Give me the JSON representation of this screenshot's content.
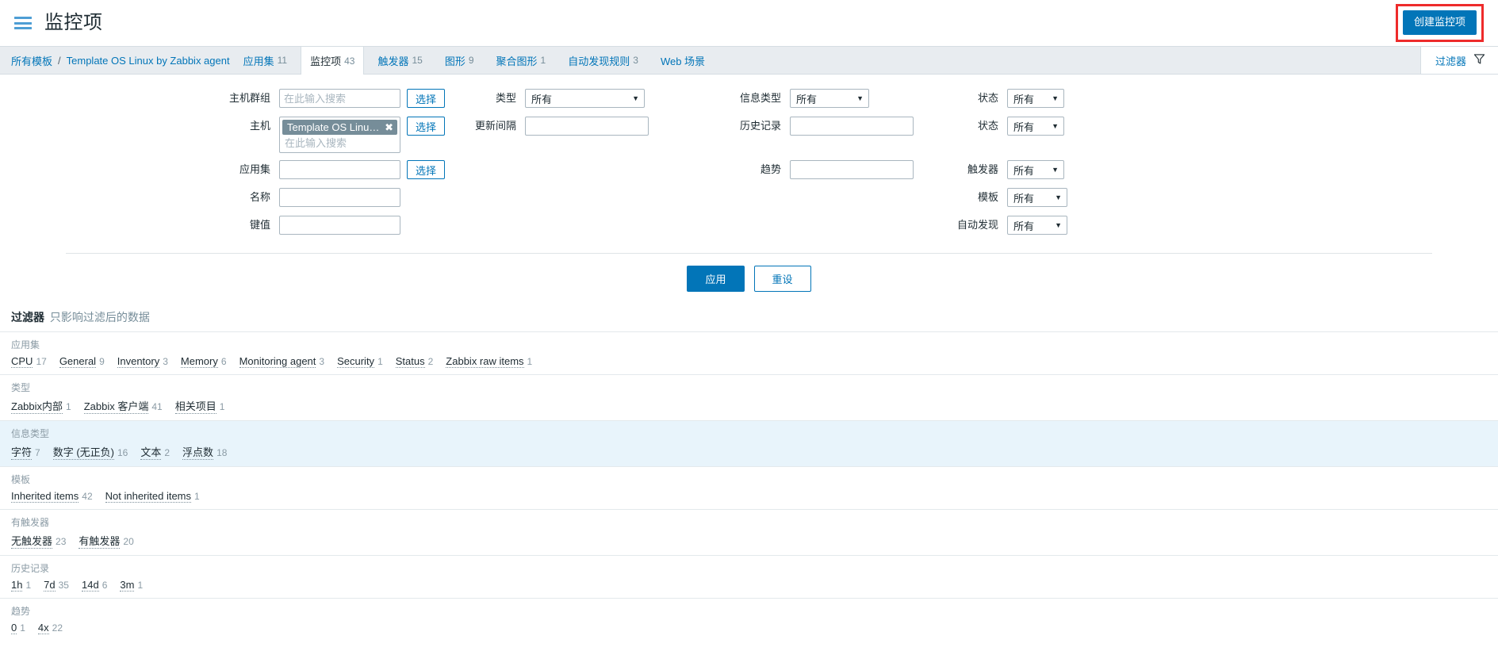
{
  "header": {
    "menu_icon": "hamburger-icon",
    "title": "监控项",
    "create_button": "创建监控项",
    "highlight_color": "#ee2b2b",
    "accent_color": "#0275b8"
  },
  "breadcrumb": {
    "all_templates": "所有模板",
    "separator": "/",
    "template_name": "Template OS Linux by Zabbix agent",
    "tabs": [
      {
        "label": "应用集",
        "count": "11",
        "selected": false
      },
      {
        "label": "监控项",
        "count": "43",
        "selected": true
      },
      {
        "label": "触发器",
        "count": "15",
        "selected": false
      },
      {
        "label": "图形",
        "count": "9",
        "selected": false
      },
      {
        "label": "聚合图形",
        "count": "1",
        "selected": false
      },
      {
        "label": "自动发现规则",
        "count": "3",
        "selected": false
      },
      {
        "label": "Web 场景",
        "count": "",
        "selected": false
      }
    ],
    "filter_tab": {
      "label": "过滤器",
      "icon": "funnel-icon"
    }
  },
  "filter": {
    "col1": {
      "host_group_label": "主机群组",
      "host_group_placeholder": "在此输入搜索",
      "host_group_value": "",
      "host_group_select": "选择",
      "host_label": "主机",
      "host_chip": "Template OS Linux ...",
      "host_chip_remove": "✖",
      "host_placeholder": "在此输入搜索",
      "host_select": "选择",
      "appset_label": "应用集",
      "appset_value": "",
      "appset_select": "选择",
      "name_label": "名称",
      "name_value": "",
      "key_label": "键值",
      "key_value": ""
    },
    "col2": {
      "type_label": "类型",
      "type_value": "所有",
      "interval_label": "更新间隔",
      "interval_value": ""
    },
    "col3": {
      "info_type_label": "信息类型",
      "info_type_value": "所有",
      "history_label": "历史记录",
      "history_value": "",
      "trend_label": "趋势",
      "trend_value": ""
    },
    "col4": {
      "state_label": "状态",
      "state_value": "所有",
      "status_label": "状态",
      "status_value": "所有",
      "trigger_label": "触发器",
      "trigger_value": "所有",
      "template_label": "模板",
      "template_value": "所有",
      "discovery_label": "自动发现",
      "discovery_value": "所有"
    },
    "apply_button": "应用",
    "reset_button": "重设"
  },
  "subfilter": {
    "heading_strong": "过滤器",
    "heading_hint": "只影响过滤后的数据",
    "groups": [
      {
        "title": "应用集",
        "alt": false,
        "items": [
          {
            "label": "CPU",
            "count": "17"
          },
          {
            "label": "General",
            "count": "9"
          },
          {
            "label": "Inventory",
            "count": "3"
          },
          {
            "label": "Memory",
            "count": "6"
          },
          {
            "label": "Monitoring agent",
            "count": "3"
          },
          {
            "label": "Security",
            "count": "1"
          },
          {
            "label": "Status",
            "count": "2"
          },
          {
            "label": "Zabbix raw items",
            "count": "1"
          }
        ]
      },
      {
        "title": "类型",
        "alt": false,
        "items": [
          {
            "label": "Zabbix内部",
            "count": "1"
          },
          {
            "label": "Zabbix 客户端",
            "count": "41"
          },
          {
            "label": "相关项目",
            "count": "1"
          }
        ]
      },
      {
        "title": "信息类型",
        "alt": true,
        "items": [
          {
            "label": "字符",
            "count": "7"
          },
          {
            "label": "数字 (无正负)",
            "count": "16"
          },
          {
            "label": "文本",
            "count": "2"
          },
          {
            "label": "浮点数",
            "count": "18"
          }
        ]
      },
      {
        "title": "模板",
        "alt": false,
        "items": [
          {
            "label": "Inherited items",
            "count": "42"
          },
          {
            "label": "Not inherited items",
            "count": "1"
          }
        ]
      },
      {
        "title": "有触发器",
        "alt": false,
        "items": [
          {
            "label": "无触发器",
            "count": "23"
          },
          {
            "label": "有触发器",
            "count": "20"
          }
        ]
      },
      {
        "title": "历史记录",
        "alt": false,
        "items": [
          {
            "label": "1h",
            "count": "1"
          },
          {
            "label": "7d",
            "count": "35"
          },
          {
            "label": "14d",
            "count": "6"
          },
          {
            "label": "3m",
            "count": "1"
          }
        ]
      },
      {
        "title": "趋势",
        "alt": false,
        "items": [
          {
            "label": "0",
            "count": "1"
          },
          {
            "label": "4x",
            "count": "22"
          }
        ]
      }
    ]
  }
}
